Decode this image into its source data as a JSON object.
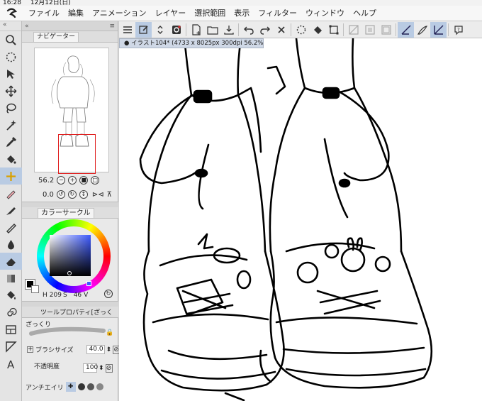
{
  "status": {
    "time": "16:28",
    "date": "12月12日(日)"
  },
  "menu": [
    "ファイル",
    "編集",
    "アニメーション",
    "レイヤー",
    "選択範囲",
    "表示",
    "フィルター",
    "ウィンドウ",
    "ヘルプ"
  ],
  "navigator": {
    "tab_label": "ナビゲーター",
    "zoom": "56.2",
    "rotation": "0.0"
  },
  "color_panel": {
    "tab_label": "カラーサークル",
    "h_label": "H",
    "h_value": "209",
    "s_label": "S",
    "s_value": "46",
    "v_label": "V"
  },
  "tool_property": {
    "tab_label": "ツールプロパティ[ざっく",
    "subtool_name": "ざっくり",
    "brush_size_label": "ブラシサイズ",
    "brush_size_value": "40.0",
    "opacity_label": "不透明度",
    "opacity_value": "100",
    "antialias_label": "アンチエイリ"
  },
  "document": {
    "tab_title": "イラスト104* (4733 x 8025px 300dpi 56.2%)"
  },
  "left_tools": [
    "magnifier-icon",
    "move-layer-icon",
    "select-icon",
    "move-icon",
    "lasso-icon",
    "auto-select-icon",
    "eyedropper-icon",
    "pen-icon",
    "pencil-icon",
    "brush-icon",
    "watercolor-icon",
    "eraser-icon",
    "blend-icon",
    "fill-icon",
    "gradient-icon",
    "frame-icon",
    "ruler-icon",
    "text-icon"
  ],
  "colors": {
    "accent": "#b9cbe3",
    "navigator_frame": "#e02020",
    "canvas": "#ffffff"
  }
}
